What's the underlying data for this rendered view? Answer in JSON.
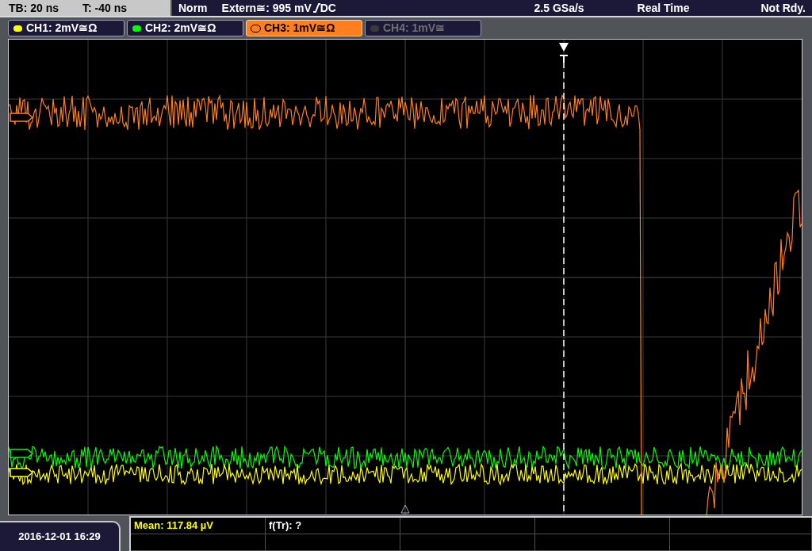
{
  "top_bar": {
    "timebase": "TB: 20 ns",
    "trigger_offset": "T: -40 ns",
    "trigger_mode": "Norm",
    "trigger_source": "Extern≅: 995 mV",
    "trigger_coupling": "DC",
    "sample_rate": "2.5 GSa/s",
    "acquisition": "Real Time",
    "status": "Not Rdy."
  },
  "channels": [
    {
      "label": "CH1: 2mV≅Ω",
      "color": "#ffff00",
      "selected": false,
      "disabled": false
    },
    {
      "label": "CH2: 2mV≅Ω",
      "color": "#00ff00",
      "selected": false,
      "disabled": false
    },
    {
      "label": "CH3: 1mV≅Ω",
      "color": "#ff7f1e",
      "selected": true,
      "disabled": false
    },
    {
      "label": "CH4: 1mV≅",
      "color": "#3a3a3a",
      "selected": false,
      "disabled": true
    }
  ],
  "measurements": [
    {
      "text": "Mean: 117.84 µV",
      "color": "#ffff00"
    },
    {
      "text": "f(Tr): ?",
      "color": "#ffffff"
    }
  ],
  "date_time": "2016-12-01 16:29"
}
